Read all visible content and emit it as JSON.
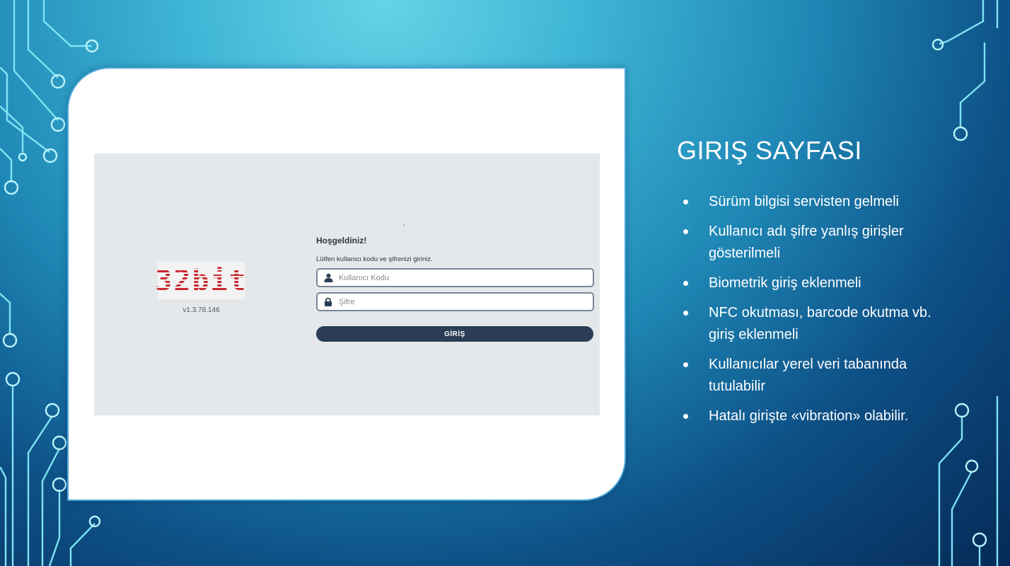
{
  "slide": {
    "title": "GIRIŞ SAYFASI",
    "bullets": [
      "Sürüm bilgisi servisten gelmeli",
      "Kullanıcı adı şifre yanlış girişler gösterilmeli",
      "Biometrik giriş eklenmeli",
      "NFC okutması, barcode okutma vb. giriş eklenmeli",
      "Kullanıcılar yerel veri tabanında tutulabilir",
      "Hatalı girişte «vibration» olabilir."
    ]
  },
  "login_screen": {
    "logo_text": "32bit",
    "version": "v1.3.78.146",
    "welcome": "Hoşgeldiniz!",
    "instruction": "Lütfen kullanıcı kodu ve şifrenizi giriniz.",
    "username_placeholder": "Kullanıcı Kodu",
    "password_placeholder": "Şifre",
    "login_button": "GİRİŞ",
    "user_icon": "user-icon",
    "lock_icon": "lock-icon"
  },
  "colors": {
    "background_light": "#66d3e6",
    "background_dark": "#062a57",
    "circuit": "#7fe3f3",
    "logo_red": "#c8282f",
    "button": "#2a3d55",
    "screenshot_bg": "#e5e8eb"
  }
}
